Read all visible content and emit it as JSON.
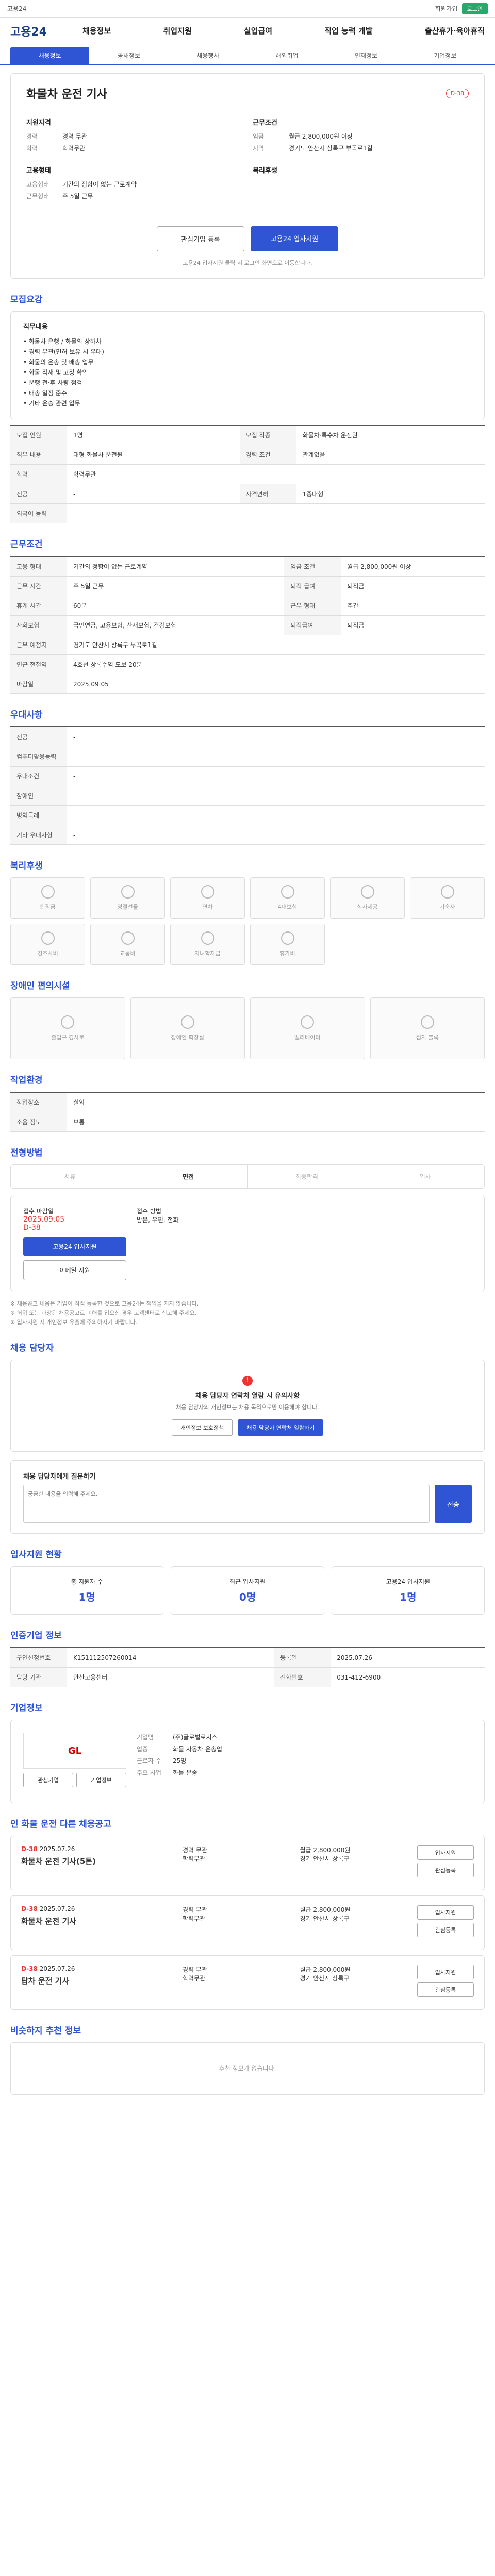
{
  "topbar": {
    "left": "고용24",
    "right_btn": "로그인",
    "right_links": [
      "회원가입"
    ]
  },
  "logo": "고용24",
  "gnb": [
    "채용정보",
    "취업지원",
    "실업급여",
    "직업 능력 개발",
    "출산휴가·육아휴직"
  ],
  "tabs": [
    "채용정보",
    "공채정보",
    "채용행사",
    "해외취업",
    "인재정보",
    "기업정보"
  ],
  "job": {
    "title": "화물차 운전 기사",
    "badge": "D-38",
    "req_title": "지원자격",
    "req_rows": [
      {
        "k": "경력",
        "v": "경력 무관"
      },
      {
        "k": "학력",
        "v": "학력무관"
      }
    ],
    "cond_title": "근무조건",
    "cond_rows": [
      {
        "k": "임금",
        "v": "월급 2,800,000원 이상"
      },
      {
        "k": "지역",
        "v": "경기도 안산시 상록구 부곡로1길"
      }
    ],
    "emp_title": "고용형태",
    "emp_rows": [
      {
        "k": "고용형태",
        "v": "기간의 정함이 없는 근로계약"
      },
      {
        "k": "근무형태",
        "v": "주 5일 근무"
      }
    ],
    "welfare_title": "복리후생",
    "btn_interest": "관심기업 등록",
    "btn_apply": "고용24 입사지원",
    "note": "고용24 입사지원 클릭 시 로그인 화면으로 이동합니다."
  },
  "sections": {
    "recruit": "모집요강",
    "work": "근무조건",
    "prefer": "우대사항",
    "welfare": "복리후생",
    "disabled": "장애인 편의시설",
    "env": "작업환경",
    "apply": "전형방법",
    "contact": "채용 담당자",
    "stats": "입사지원 현황",
    "info": "인증기업 정보",
    "company": "기업정보",
    "other": "인 화물 운전 다른 채용공고",
    "similar": "비슷하지 추천 정보"
  },
  "duty": {
    "title": "직무내용",
    "lines": [
      "• 화물차 운행 / 화물의 상하차",
      "• 경력 무관(면허 보유 시 우대)",
      "• 화물의 운송 및 배송 업무",
      "• 화물 적재 및 고정 확인",
      "• 운행 전·후 차량 점검",
      "• 배송 일정 준수",
      "• 기타 운송 관련 업무"
    ]
  },
  "recruit_table": [
    {
      "k1": "모집 인원",
      "v1": "1명",
      "k2": "모집 직종",
      "v2": "화물차·특수차 운전원"
    },
    {
      "k1": "직무 내용",
      "v1": "대형 화물차 운전원",
      "k2": "경력 조건",
      "v2": "관계없음"
    },
    {
      "k1": "학력",
      "v1": "학력무관",
      "k2": "",
      "v2": ""
    },
    {
      "k1": "전공",
      "v1": "-",
      "k2": "자격면허",
      "v2": "1종대형"
    },
    {
      "k1": "외국어 능력",
      "v1": "-",
      "k2": "",
      "v2": ""
    }
  ],
  "work_table": [
    {
      "k1": "고용 형태",
      "v1": "기간의 정함이 없는 근로계약",
      "k2": "임금 조건",
      "v2": "월급 2,800,000원 이상"
    },
    {
      "k1": "근무 시간",
      "v1": "주 5일 근무",
      "k2": "퇴직 급여",
      "v2": "퇴직금"
    },
    {
      "k1": "휴게 시간",
      "v1": "60분",
      "k2": "근무 형태",
      "v2": "주간"
    },
    {
      "k1": "사회보험",
      "v1": "국민연금, 고용보험, 산재보험, 건강보험",
      "k2": "퇴직급여",
      "v2": "퇴직금"
    },
    {
      "k1": "근무 예정지",
      "v1": "경기도 안산시 상록구 부곡로1길",
      "k2": "",
      "v2": ""
    },
    {
      "k1": "인근 전철역",
      "v1": "4호선 상록수역 도보 20분",
      "k2": "",
      "v2": ""
    },
    {
      "k1": "마감일",
      "v1": "2025.09.05",
      "k2": "",
      "v2": ""
    }
  ],
  "prefer_table": [
    {
      "k": "전공",
      "v": "-"
    },
    {
      "k": "컴퓨터활용능력",
      "v": "-"
    },
    {
      "k": "우대조건",
      "v": "-"
    },
    {
      "k": "장애인",
      "v": "-"
    },
    {
      "k": "병역특례",
      "v": "-"
    },
    {
      "k": "기타 우대사항",
      "v": "-"
    }
  ],
  "welfare_items": [
    "퇴직금",
    "명절선물",
    "연차",
    "4대보험",
    "식사제공",
    "기숙사",
    "경조사비",
    "교통비",
    "자녀학자금",
    "휴가비"
  ],
  "disabled_items": [
    "출입구 경사로",
    "장애인 화장실",
    "엘리베이터",
    "점자 블록"
  ],
  "env_table": [
    {
      "k1": "작업장소",
      "v1": "실외",
      "k2": "",
      "v2": ""
    },
    {
      "k1": "소음 정도",
      "v1": "보통",
      "k2": "",
      "v2": ""
    }
  ],
  "steps": [
    "서류",
    "면접",
    "최종합격",
    "입사"
  ],
  "apply": {
    "deadline_label": "접수 마감일",
    "deadline": "2025.09.05",
    "dday": "D-38",
    "method_label": "접수 방법",
    "method": "방문, 우편, 전화",
    "btn1": "고용24 입사지원",
    "btn2": "이메일 지원"
  },
  "notices": [
    "※ 채용공고 내용은 기업이 직접 등록한 것으로 고용24는 책임을 지지 않습니다.",
    "※ 허위 또는 과장된 채용공고로 피해를 입으신 경우 고객센터로 신고해 주세요.",
    "※ 입사지원 시 개인정보 유출에 주의하시기 바랍니다."
  ],
  "contact": {
    "title": "채용 담당자 연락처 열람 시 유의사항",
    "desc": "채용 담당자의 개인정보는 채용 목적으로만 이용해야 합니다.",
    "btn1": "개인정보 보호정책",
    "btn2": "채용 담당자 연락처 열람하기"
  },
  "qa": {
    "title": "채용 담당자에게 질문하기",
    "placeholder": "궁금한 내용을 입력해 주세요.",
    "send": "전송"
  },
  "stats": [
    {
      "k": "총 지원자 수",
      "v": "1명"
    },
    {
      "k": "최근 입사지원",
      "v": "0명"
    },
    {
      "k": "고용24 입사지원",
      "v": "1명"
    }
  ],
  "info_table": [
    {
      "k1": "구인신청번호",
      "v1": "K151112507260014",
      "k2": "등록일",
      "v2": "2025.07.26"
    },
    {
      "k1": "담당 기관",
      "v1": "안산고용센터",
      "k2": "전화번호",
      "v2": "031-412-6900"
    }
  ],
  "company": {
    "logo": "GL",
    "btn1": "관심기업",
    "btn2": "기업정보",
    "rows": [
      {
        "k": "기업명",
        "v": "(주)글로벌로지스"
      },
      {
        "k": "업종",
        "v": "화물 자동차 운송업"
      },
      {
        "k": "근로자 수",
        "v": "25명"
      },
      {
        "k": "주요 사업",
        "v": "화물 운송"
      }
    ]
  },
  "other_jobs": [
    {
      "dday": "D-38",
      "date": "2025.07.26",
      "title": "화물차 운전 기사(5톤)",
      "cond1": "경력 무관",
      "cond2": "학력무관",
      "pay": "월급 2,800,000원",
      "loc": "경기 안산시 상록구"
    },
    {
      "dday": "D-38",
      "date": "2025.07.26",
      "title": "화물차 운전 기사",
      "cond1": "경력 무관",
      "cond2": "학력무관",
      "pay": "월급 2,800,000원",
      "loc": "경기 안산시 상록구"
    },
    {
      "dday": "D-38",
      "date": "2025.07.26",
      "title": "탑차 운전 기사",
      "cond1": "경력 무관",
      "cond2": "학력무관",
      "pay": "월급 2,800,000원",
      "loc": "경기 안산시 상록구"
    }
  ],
  "list_btns": [
    "입사지원",
    "관심등록"
  ],
  "similar_empty": "추천 정보가 없습니다."
}
